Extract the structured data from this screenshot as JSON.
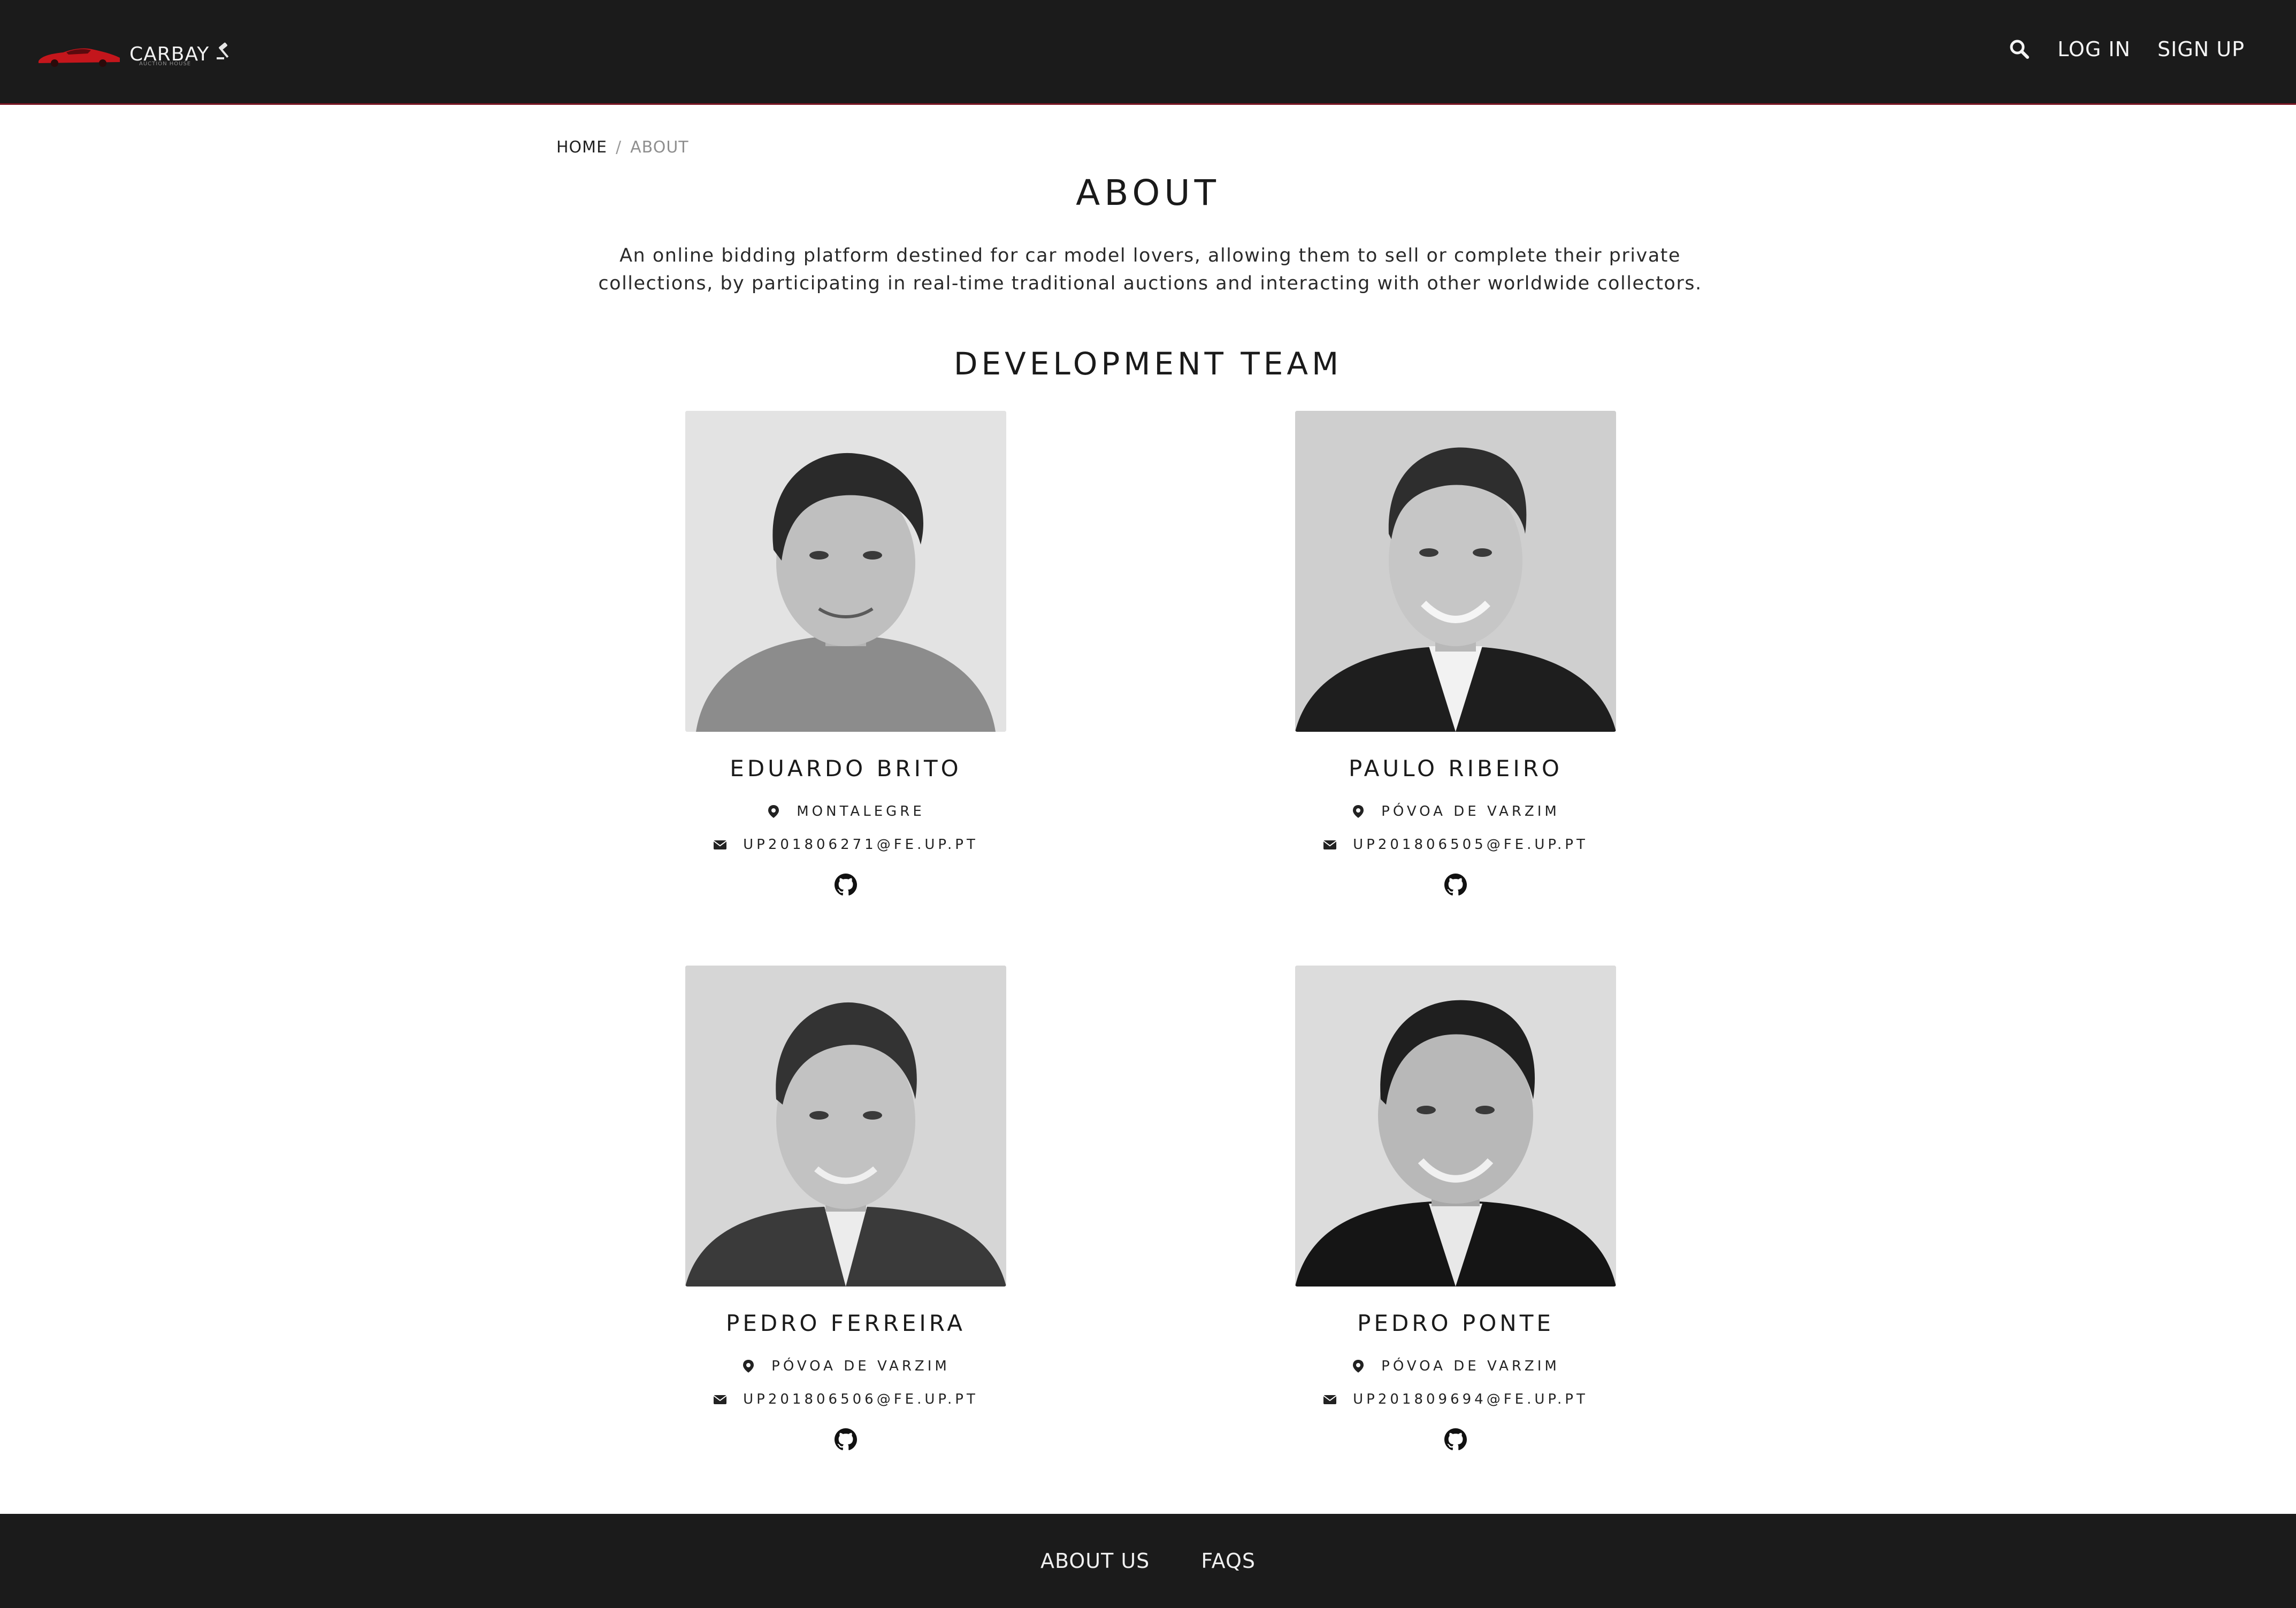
{
  "header": {
    "brand": "CARBAY",
    "brand_subtitle": "AUCTION HOUSE",
    "log_in": "LOG IN",
    "sign_up": "SIGN UP",
    "icons": {
      "logo": "red-car-logo",
      "brand_mark": "gavel-icon",
      "search": "search-icon"
    }
  },
  "breadcrumb": {
    "home": "HOME",
    "separator": "/",
    "current": "ABOUT"
  },
  "page": {
    "title": "ABOUT",
    "description": "An online bidding platform destined for car model lovers, allowing them to sell or complete their private collections, by participating in real-time traditional auctions and interacting with other worldwide collectors.",
    "team_title": "DEVELOPMENT TEAM"
  },
  "team": [
    {
      "name": "EDUARDO BRITO",
      "location": "MONTALEGRE",
      "email": "UP201806271@FE.UP.PT"
    },
    {
      "name": "PAULO RIBEIRO",
      "location": "PÓVOA DE VARZIM",
      "email": "UP201806505@FE.UP.PT"
    },
    {
      "name": "PEDRO FERREIRA",
      "location": "PÓVOA DE VARZIM",
      "email": "UP201806506@FE.UP.PT"
    },
    {
      "name": "PEDRO PONTE",
      "location": "PÓVOA DE VARZIM",
      "email": "UP201809694@FE.UP.PT"
    }
  ],
  "footer": {
    "about_us": "ABOUT US",
    "faqs": "FAQS"
  },
  "colors": {
    "navbar": "#1b1b1b",
    "accent": "#c4161c",
    "text": "#1a1a1a",
    "muted": "#8f8f8f"
  }
}
